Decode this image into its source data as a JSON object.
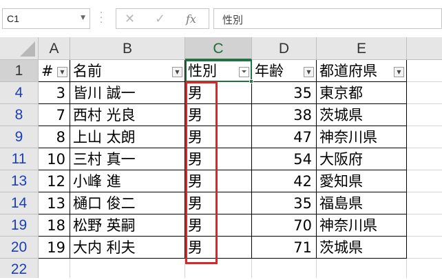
{
  "formula_bar": {
    "name_box": "C1",
    "cancel_symbol": "✕",
    "enter_symbol": "✓",
    "function_symbol": "fx",
    "content": "性別"
  },
  "columns": [
    "A",
    "B",
    "C",
    "D",
    "E"
  ],
  "header_row": {
    "row_number": "1",
    "cells": [
      "#",
      "名前",
      "性別",
      "年齢",
      "都道府県"
    ]
  },
  "rows": [
    {
      "row_number": "4",
      "num": "3",
      "name": "皆川 誠一",
      "gender": "男",
      "age": "35",
      "pref": "東京都"
    },
    {
      "row_number": "8",
      "num": "7",
      "name": "西村 光良",
      "gender": "男",
      "age": "38",
      "pref": "茨城県"
    },
    {
      "row_number": "9",
      "num": "8",
      "name": "上山 太朗",
      "gender": "男",
      "age": "47",
      "pref": "神奈川県"
    },
    {
      "row_number": "11",
      "num": "10",
      "name": "三村 真一",
      "gender": "男",
      "age": "54",
      "pref": "大阪府"
    },
    {
      "row_number": "13",
      "num": "12",
      "name": "小峰 進",
      "gender": "男",
      "age": "42",
      "pref": "愛知県"
    },
    {
      "row_number": "14",
      "num": "13",
      "name": "樋口 俊二",
      "gender": "男",
      "age": "35",
      "pref": "福島県"
    },
    {
      "row_number": "19",
      "num": "18",
      "name": "松野 英嗣",
      "gender": "男",
      "age": "70",
      "pref": "神奈川県"
    },
    {
      "row_number": "20",
      "num": "19",
      "name": "大内 利夫",
      "gender": "男",
      "age": "71",
      "pref": "茨城県"
    }
  ],
  "extra_row": {
    "row_number": "22"
  },
  "colors": {
    "selection": "#217346",
    "highlight_box": "#d62828",
    "row_number_filtered": "#1a3fb5"
  }
}
